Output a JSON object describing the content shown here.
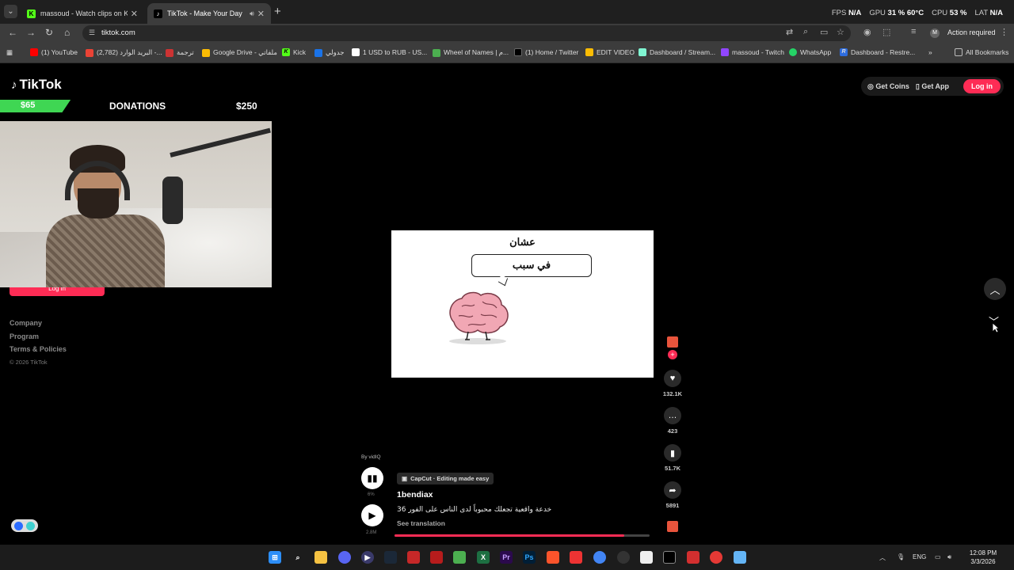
{
  "browser": {
    "tabs": [
      {
        "title": "massoud - Watch clips on Kick",
        "active": false
      },
      {
        "title": "TikTok - Make Your Day",
        "active": true
      }
    ],
    "stats": {
      "fps_label": "FPS",
      "fps_value": "N/A",
      "gpu_label": "GPU",
      "gpu_value": "31 % 60°C",
      "cpu_label": "CPU",
      "cpu_value": "53 %",
      "lat_label": "LAT",
      "lat_value": "N/A"
    },
    "url": "tiktok.com",
    "action_required": "Action required",
    "bookmarks": [
      "(1) YouTube",
      "(2,782) البريد الوارد -...",
      "ترجمة",
      "Google Drive - ملفاتي",
      "Kick",
      "جدولي",
      "1 USD to RUB - US...",
      "Wheel of Names | م...",
      "(1) Home / Twitter",
      "EDIT VIDEO",
      "Dashboard / Stream...",
      "massoud - Twitch",
      "WhatsApp",
      "Dashboard - Restre..."
    ],
    "all_bookmarks": "All Bookmarks"
  },
  "tiktok": {
    "logo": "TikTok",
    "header": {
      "get_coins": "Get Coins",
      "get_app": "Get App",
      "login": "Log in"
    },
    "sidebar_login": "Log in",
    "footer": [
      "Company",
      "Program",
      "Terms & Policies"
    ],
    "copyright": "© 2026 TikTok",
    "video": {
      "title": "عشان",
      "bubble": "في سبب"
    },
    "actions": {
      "likes": "132.1K",
      "comments": "423",
      "saves": "51.7K",
      "shares": "5891"
    },
    "byline": "By vidIQ",
    "views1": "6%",
    "views2": "2.8M",
    "capcut": "CapCut · Editing made easy",
    "author": "1bendiax",
    "caption": "خدعة واقعية تجعلك محبوباً لدى الناس على الفور 36",
    "see_translation": "See translation",
    "progress": 0.9
  },
  "overlay": {
    "donation_current": "$65",
    "donation_title": "DONATIONS",
    "donation_goal": "$250",
    "progress": 0.26
  },
  "taskbar": {
    "lang": "ENG",
    "time": "12:08 PM",
    "date": "3/3/2026"
  },
  "colors": {
    "accent": "#fe2c55",
    "donation": "#3fd653"
  }
}
